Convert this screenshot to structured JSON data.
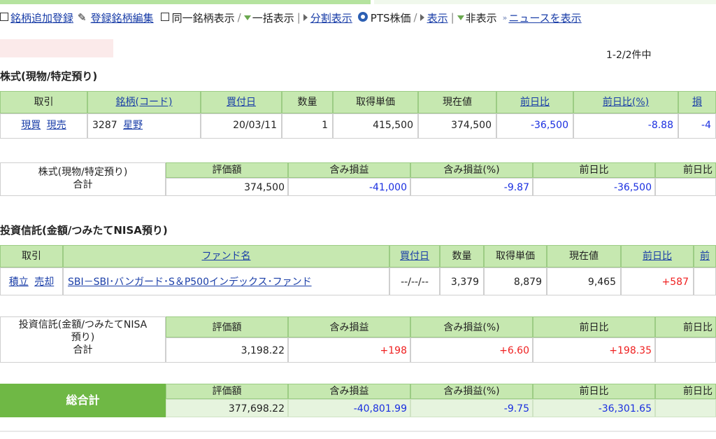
{
  "toolbar": {
    "add_registration": "銘柄追加登録",
    "edit_registration": "登録銘柄編集",
    "same_stock_display": "同一銘柄表示",
    "bulk_display": "一括表示",
    "split_display": "分割表示",
    "pts_price": "PTS株価",
    "show": "表示",
    "hide": "非表示",
    "show_news": "ニュースを表示"
  },
  "count": "1-2/2件中",
  "stocks": {
    "title": "株式(現物/特定預り)",
    "headers": [
      "取引",
      "銘柄(コード)",
      "買付日",
      "数量",
      "取得単価",
      "現在値",
      "前日比",
      "前日比(%)",
      "損"
    ],
    "row": {
      "buy": "現買",
      "sell": "現売",
      "code": "3287",
      "name": "星野",
      "date": "20/03/11",
      "qty": "1",
      "cost": "415,500",
      "price": "374,500",
      "change": "-36,500",
      "change_pct": "-8.88",
      "pl": "-4"
    },
    "summary": {
      "label_line1": "株式(現物/特定預り)",
      "label_line2": "合計",
      "headers": [
        "評価額",
        "含み損益",
        "含み損益(%)",
        "前日比",
        "前日比"
      ],
      "values": [
        "374,500",
        "-41,000",
        "-9.87",
        "-36,500",
        ""
      ]
    }
  },
  "funds": {
    "title": "投資信託(金額/つみたてNISA預り)",
    "headers": [
      "取引",
      "ファンド名",
      "買付日",
      "数量",
      "取得単価",
      "現在値",
      "前日比",
      "前"
    ],
    "row": {
      "buy": "積立",
      "sell": "売却",
      "name": "SBI－SBI･バンガード･S＆P500インデックス･ファンド",
      "date": "--/--/--",
      "qty": "3,379",
      "cost": "8,879",
      "price": "9,465",
      "change": "+587"
    },
    "summary": {
      "label_line1": "投資信託(金額/つみたてNISA",
      "label_line2": "預り)",
      "label_line3": "合計",
      "headers": [
        "評価額",
        "含み損益",
        "含み損益(%)",
        "前日比",
        "前日比"
      ],
      "values": [
        "3,198.22",
        "+198",
        "+6.60",
        "+198.35",
        ""
      ]
    }
  },
  "total": {
    "label": "総合計",
    "headers": [
      "評価額",
      "含み損益",
      "含み損益(%)",
      "前日比",
      "前日比"
    ],
    "values": [
      "377,698.22",
      "-40,801.99",
      "-9.75",
      "-36,301.65",
      ""
    ]
  },
  "colors": {
    "header_green": "#c6e8b0",
    "total_green": "#6fb845",
    "negative_blue": "#1a2fe0",
    "positive_red": "#ef2020",
    "link_blue": "#1a3ea8"
  }
}
